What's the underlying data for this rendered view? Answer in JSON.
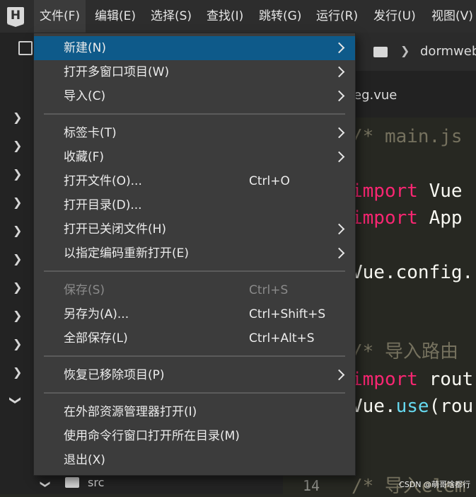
{
  "menubar": {
    "items": [
      {
        "label": "文件(F)"
      },
      {
        "label": "编辑(E)"
      },
      {
        "label": "选择(S)"
      },
      {
        "label": "查找(I)"
      },
      {
        "label": "跳转(G)"
      },
      {
        "label": "运行(R)"
      },
      {
        "label": "发行(U)"
      },
      {
        "label": "视图(V)"
      }
    ]
  },
  "file_menu": {
    "items": [
      {
        "label": "新建(N)",
        "submenu": true,
        "highlighted": true
      },
      {
        "label": "打开多窗口项目(W)",
        "submenu": true
      },
      {
        "label": "导入(C)",
        "submenu": true
      },
      {
        "label": "标签卡(T)",
        "submenu": true
      },
      {
        "label": "收藏(F)",
        "submenu": true
      },
      {
        "label": "打开文件(O)...",
        "shortcut": "Ctrl+O"
      },
      {
        "label": "打开目录(D)..."
      },
      {
        "label": "打开已关闭文件(H)",
        "submenu": true
      },
      {
        "label": "以指定编码重新打开(E)",
        "submenu": true
      },
      {
        "label": "保存(S)",
        "shortcut": "Ctrl+S",
        "disabled": true
      },
      {
        "label": "另存为(A)...",
        "shortcut": "Ctrl+Shift+S"
      },
      {
        "label": "全部保存(L)",
        "shortcut": "Ctrl+Alt+S"
      },
      {
        "label": "恢复已移除项目(P)",
        "submenu": true
      },
      {
        "label": "在外部资源管理器打开(I)"
      },
      {
        "label": "使用命令行窗口打开所在目录(M)"
      },
      {
        "label": "退出(X)"
      }
    ]
  },
  "editor": {
    "breadcrumb": "dormweb",
    "tab_label": "eg.vue",
    "line_number": "14",
    "code_lines": [
      {
        "text": "/* main.js",
        "style": "comment"
      },
      {
        "text": "import Vue",
        "style": "import"
      },
      {
        "text": "import App",
        "style": "import"
      },
      {
        "text": "Vue.config.",
        "style": "plain"
      },
      {
        "text": "/* 导入路由",
        "style": "comment"
      },
      {
        "text": "import rout",
        "style": "import"
      },
      {
        "text": "Vue.use(rou",
        "style": "use"
      },
      {
        "text": "/* 导入elem",
        "style": "comment"
      }
    ]
  },
  "sidebar": {
    "folder_label": "src"
  },
  "watermark": "CSDN @萌哥啥都行",
  "colors": {
    "menu_highlight": "#0e5a8a",
    "menu_bg": "#3c3c3c",
    "keyword": "#f92672",
    "comment": "#75715e"
  }
}
